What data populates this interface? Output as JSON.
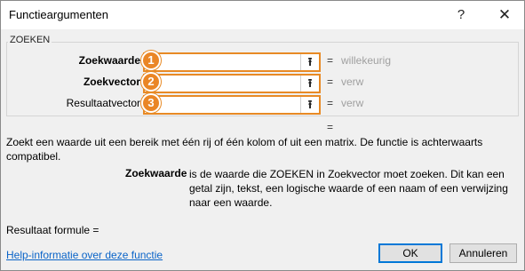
{
  "window": {
    "title": "Functieargumenten",
    "help_glyph": "?",
    "close_glyph": "✕"
  },
  "group": {
    "label": "ZOEKEN"
  },
  "arguments": [
    {
      "label": "Zoekwaarde",
      "badge": "1",
      "value": "",
      "collapse_glyph": "⭱",
      "eq": "=",
      "result": "willekeurig"
    },
    {
      "label": "Zoekvector",
      "badge": "2",
      "value": "",
      "collapse_glyph": "⭱",
      "eq": "=",
      "result": "verw"
    },
    {
      "label": "Resultaatvector",
      "badge": "3",
      "value": "",
      "collapse_glyph": "⭱",
      "eq": "=",
      "result": "verw"
    }
  ],
  "function_result_eq": "=",
  "description": "Zoekt een waarde uit een bereik met één rij of één kolom of uit een matrix. De functie is achterwaarts compatibel.",
  "arg_help": {
    "name": "Zoekwaarde",
    "text": "is de waarde die ZOEKEN in Zoekvector moet zoeken. Dit kan een getal zijn, tekst, een logische waarde of een naam of een verwijzing naar een waarde."
  },
  "formula_result": "Resultaat formule =",
  "help_link": "Help-informatie over deze functie",
  "buttons": {
    "ok": "OK",
    "cancel": "Annuleren"
  },
  "colors": {
    "accent_orange": "#ea8626",
    "link": "#0a64c8",
    "muted_value": "#a0a0a0"
  }
}
